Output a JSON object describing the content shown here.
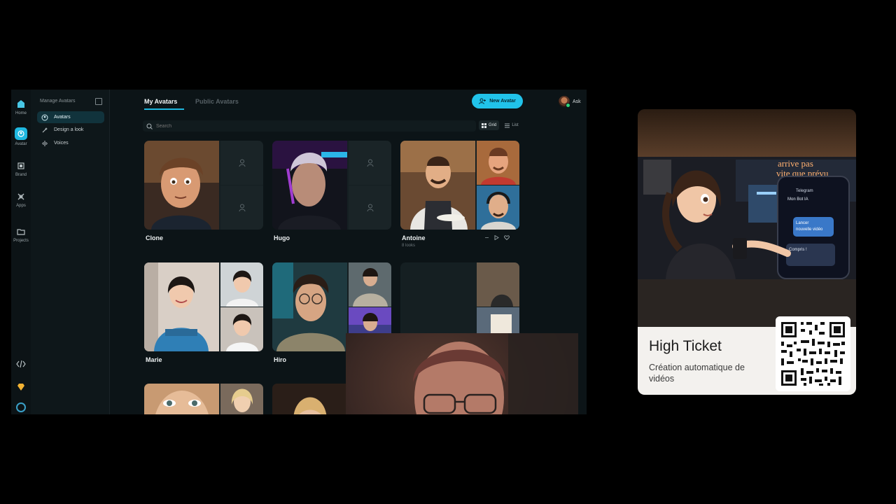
{
  "app": {
    "rail": [
      {
        "label": "Home",
        "icon": "home-icon"
      },
      {
        "label": "Avatar",
        "icon": "avatar-icon"
      },
      {
        "label": "Brand",
        "icon": "brand-icon"
      },
      {
        "label": "Apps",
        "icon": "apps-icon"
      },
      {
        "label": "Projects",
        "icon": "folder-icon"
      }
    ],
    "sidebar": {
      "title": "Manage Avatars",
      "items": [
        {
          "label": "Avatars",
          "icon": "avatar-icon",
          "active": true
        },
        {
          "label": "Design a look",
          "icon": "wand-icon",
          "active": false
        },
        {
          "label": "Voices",
          "icon": "voice-icon",
          "active": false
        }
      ]
    },
    "tabs": [
      {
        "label": "My Avatars",
        "active": true
      },
      {
        "label": "Public Avatars",
        "active": false
      }
    ],
    "new_avatar_label": "New Avatar",
    "ask_label": "Ask",
    "search_placeholder": "Search",
    "view_toggle": {
      "grid": "Grid",
      "list": "List",
      "selected": "Grid"
    },
    "avatars": [
      {
        "name": "Clone",
        "sub": ""
      },
      {
        "name": "Hugo",
        "sub": ""
      },
      {
        "name": "Antoine",
        "sub": "8 looks"
      },
      {
        "name": "Marie",
        "sub": ""
      },
      {
        "name": "Hiro",
        "sub": ""
      }
    ]
  },
  "promo": {
    "title": "High Ticket",
    "subtitle": "Création automatique de vidéos",
    "image_sign_text": "arrive pas vite que prévu",
    "phone_app": "Telegram",
    "phone_chat": "Mon Bot IA",
    "phone_message_1": "Lancer nouvelle vidéo",
    "phone_message_2": "Compris !"
  },
  "colors": {
    "accent": "#21c3ea",
    "app_bg": "#0c1417",
    "page_bg": "#000000",
    "promo_label_bg": "#f3f1ee"
  }
}
